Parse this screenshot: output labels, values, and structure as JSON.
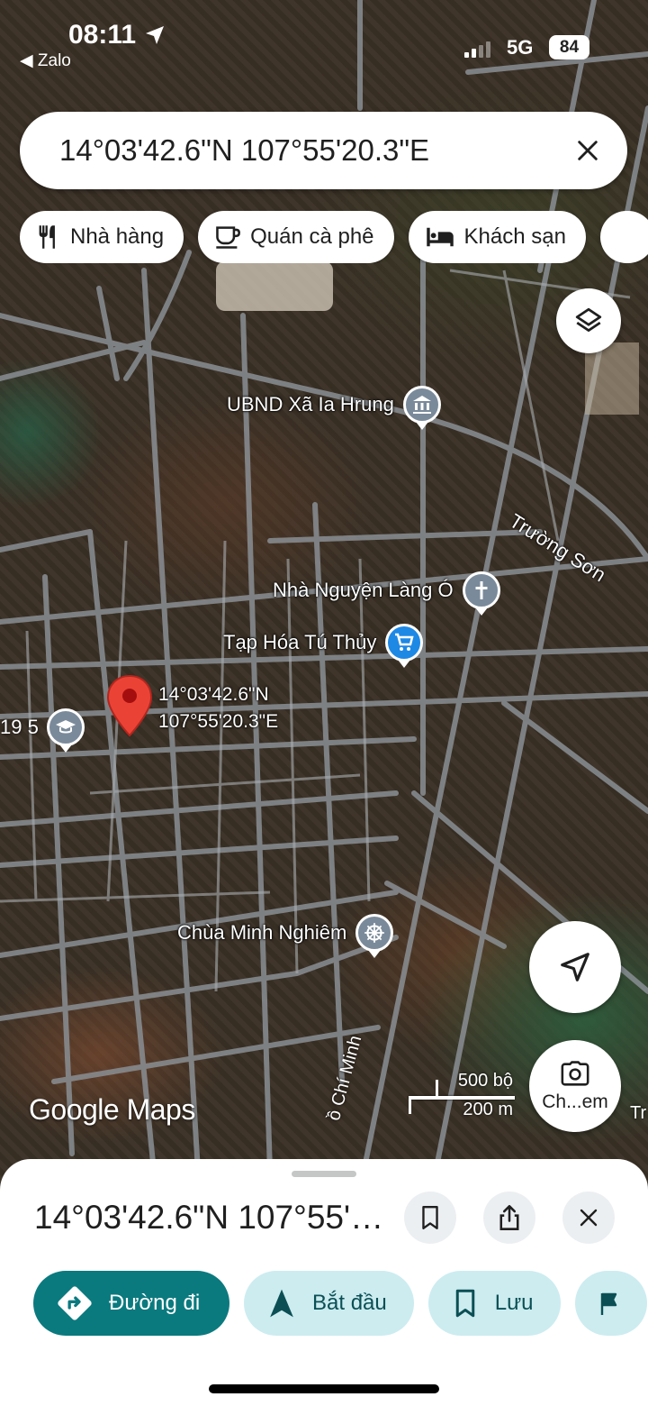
{
  "status_bar": {
    "time": "08:11",
    "back_app": "◀ Zalo",
    "network": "5G",
    "battery": "84"
  },
  "search": {
    "value": "14°03'42.6\"N 107°55'20.3\"E"
  },
  "chips": [
    {
      "label": "Nhà hàng",
      "icon": "restaurant-icon"
    },
    {
      "label": "Quán cà phê",
      "icon": "coffee-icon"
    },
    {
      "label": "Khách sạn",
      "icon": "hotel-icon"
    }
  ],
  "map": {
    "pois": [
      {
        "label": "UBND Xã Ia Hrung",
        "icon": "government-icon"
      },
      {
        "label": "Nhà Nguyện Làng Ó",
        "icon": "church-icon"
      },
      {
        "label": "Tạp Hóa Tú Thủy",
        "icon": "shopping-cart-icon"
      },
      {
        "label": "Chùa Minh Nghiêm",
        "icon": "temple-icon"
      }
    ],
    "pin_label": {
      "line1": "14°03'42.6\"N",
      "line2": "107°55'20.3\"E"
    },
    "road_labels": {
      "truong_son": "Trường Sơn",
      "bottom_road": "ồ Chí Minh"
    },
    "school_label": "19 5",
    "logo": "Google Maps",
    "scale": {
      "imperial": "500 bộ",
      "metric": "200 m"
    },
    "edge_text": "Tr"
  },
  "lens_button": {
    "label": "Ch...em"
  },
  "sheet": {
    "title": "14°03'42.6\"N 107°55'20.3\"E",
    "actions": [
      {
        "label": "Đường đi",
        "icon": "directions-icon"
      },
      {
        "label": "Bắt đầu",
        "icon": "navigation-icon"
      },
      {
        "label": "Lưu",
        "icon": "bookmark-icon"
      },
      {
        "label": "",
        "icon": "flag-icon"
      }
    ]
  },
  "colors": {
    "primary_action": "#0b7a7f",
    "secondary_action": "#ccecf0",
    "pin_red": "#ea4335",
    "poi_blue": "#1e88e5"
  }
}
